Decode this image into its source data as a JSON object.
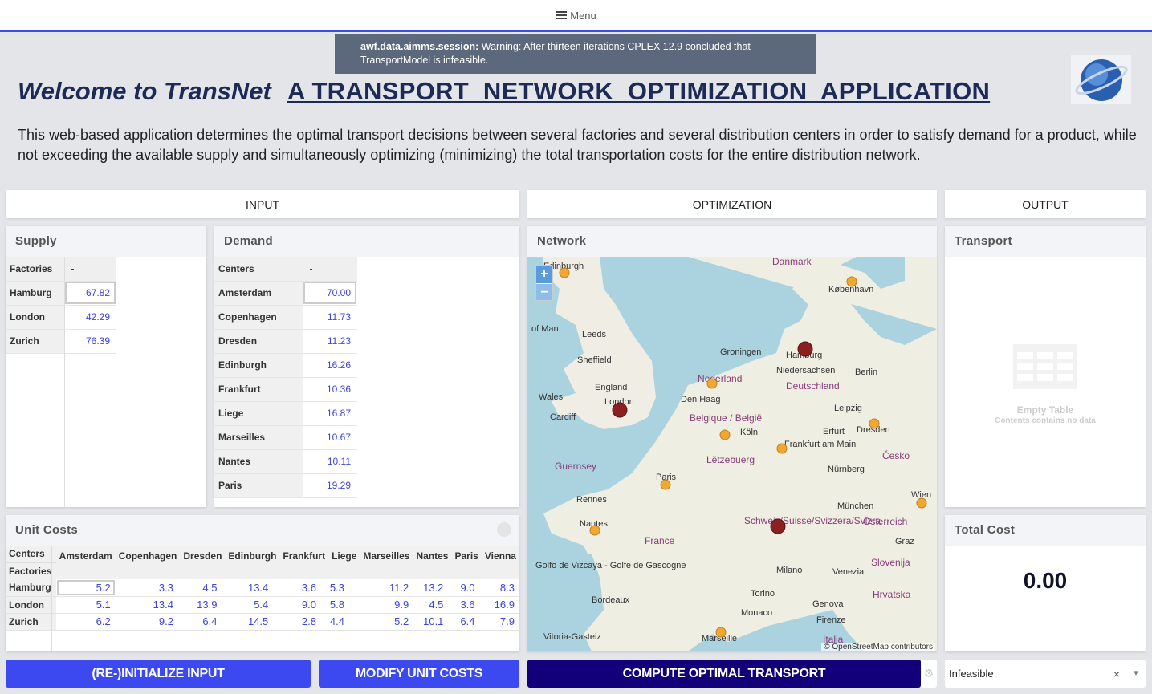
{
  "menu": {
    "label": "Menu"
  },
  "warning": {
    "source": "awf.data.aimms.session:",
    "message": " Warning: After thirteen iterations CPLEX 12.9 concluded that TransportModel is infeasible."
  },
  "header": {
    "welcome": "Welcome to TransNet",
    "title": "A TRANSPORT  NETWORK  OPTIMIZATION  APPLICATION",
    "intro": "This web-based application determines the optimal transport decisions between several factories and several distribution centers in order to satisfy demand for a product, while not exceeding the available supply and simultaneously optimizing (minimizing) the total transportation costs for the entire distribution network."
  },
  "tabs": [
    "INPUT",
    "OPTIMIZATION",
    "OUTPUT"
  ],
  "supply": {
    "title": "Supply",
    "col_header": "Factories",
    "dash": "-",
    "rows": [
      {
        "name": "Hamburg",
        "value": "67.82"
      },
      {
        "name": "London",
        "value": "42.29"
      },
      {
        "name": "Zurich",
        "value": "76.39"
      }
    ]
  },
  "demand": {
    "title": "Demand",
    "col_header": "Centers",
    "dash": "-",
    "rows": [
      {
        "name": "Amsterdam",
        "value": "70.00"
      },
      {
        "name": "Copenhagen",
        "value": "11.73"
      },
      {
        "name": "Dresden",
        "value": "11.23"
      },
      {
        "name": "Edinburgh",
        "value": "16.26"
      },
      {
        "name": "Frankfurt",
        "value": "10.36"
      },
      {
        "name": "Liege",
        "value": "16.87"
      },
      {
        "name": "Marseilles",
        "value": "10.67"
      },
      {
        "name": "Nantes",
        "value": "10.11"
      },
      {
        "name": "Paris",
        "value": "19.29"
      }
    ]
  },
  "network": {
    "title": "Network",
    "attribution": "© OpenStreetMap contributors",
    "zoom_in": "+",
    "zoom_out": "−",
    "labels": [
      "Edinburgh",
      "Danmark",
      "København",
      "of Man",
      "Leeds",
      "Sheffield",
      "Groningen",
      "Hamburg",
      "Nederland",
      "Berlin",
      "Niedersachsen",
      "Deutschland",
      "Wales",
      "England",
      "London",
      "Den Haag",
      "Cardiff",
      "Belgique / België",
      "Leipzig",
      "Dresden",
      "Köln",
      "Erfurt",
      "Frankfurt am Main",
      "Lëtzebuerg",
      "Guernsey",
      "Paris",
      "Nürnberg",
      "Česko",
      "Rennes",
      "München",
      "Wien",
      "Nantes",
      "Schweiz/Suisse/Svizzera/Svizra",
      "France",
      "Österreich",
      "Graz",
      "Slovenija",
      "Milano",
      "Venezia",
      "Torino",
      "Hrvatska",
      "Genova",
      "Bordeaux",
      "Monaco",
      "Firenze",
      "Marseille",
      "Vitoria-Gasteiz",
      "Italia",
      "Golfo de Vizcaya - Golfe de Gascogne"
    ],
    "markers": [
      {
        "name": "Edinburgh",
        "type": "center"
      },
      {
        "name": "Copenhagen",
        "type": "center"
      },
      {
        "name": "Hamburg",
        "type": "factory"
      },
      {
        "name": "Amsterdam",
        "type": "center"
      },
      {
        "name": "London",
        "type": "factory"
      },
      {
        "name": "Liege",
        "type": "center"
      },
      {
        "name": "Frankfurt",
        "type": "center"
      },
      {
        "name": "Dresden",
        "type": "center"
      },
      {
        "name": "Paris",
        "type": "center"
      },
      {
        "name": "Zurich",
        "type": "factory"
      },
      {
        "name": "Nantes",
        "type": "center"
      },
      {
        "name": "Vienna",
        "type": "center"
      },
      {
        "name": "Marseilles",
        "type": "center"
      }
    ],
    "colors": {
      "factory": "#8b2020",
      "center": "#f0a830"
    }
  },
  "transport": {
    "title": "Transport",
    "empty_title": "Empty Table",
    "empty_sub": "Contents contains no data"
  },
  "unit_costs": {
    "title": "Unit Costs",
    "row_header_top": "Centers",
    "row_header_bottom": "Factories",
    "columns": [
      "Amsterdam",
      "Copenhagen",
      "Dresden",
      "Edinburgh",
      "Frankfurt",
      "Liege",
      "Marseilles",
      "Nantes",
      "Paris",
      "Vienna"
    ],
    "rows": [
      {
        "name": "Hamburg",
        "values": [
          "5.2",
          "3.3",
          "4.5",
          "13.4",
          "3.6",
          "5.3",
          "11.2",
          "13.2",
          "9.0",
          "8.3"
        ]
      },
      {
        "name": "London",
        "values": [
          "5.1",
          "13.4",
          "13.9",
          "5.4",
          "9.0",
          "5.8",
          "9.9",
          "4.5",
          "3.6",
          "16.9"
        ]
      },
      {
        "name": "Zurich",
        "values": [
          "6.2",
          "9.2",
          "6.4",
          "14.5",
          "2.8",
          "4.4",
          "5.2",
          "10.1",
          "6.4",
          "7.9"
        ]
      }
    ]
  },
  "total_cost": {
    "title": "Total Cost",
    "value": "0.00"
  },
  "buttons": {
    "init": "(RE-)INITIALIZE INPUT",
    "modify": "MODIFY UNIT COSTS",
    "compute": "COMPUTE OPTIMAL TRANSPORT"
  },
  "status_select": {
    "value": "Infeasible",
    "clear": "×",
    "arrow": "▾"
  },
  "colors": {
    "accent": "#3c48f0",
    "compute": "#12007a",
    "title": "#1c2a55",
    "value": "#3b45e0"
  }
}
